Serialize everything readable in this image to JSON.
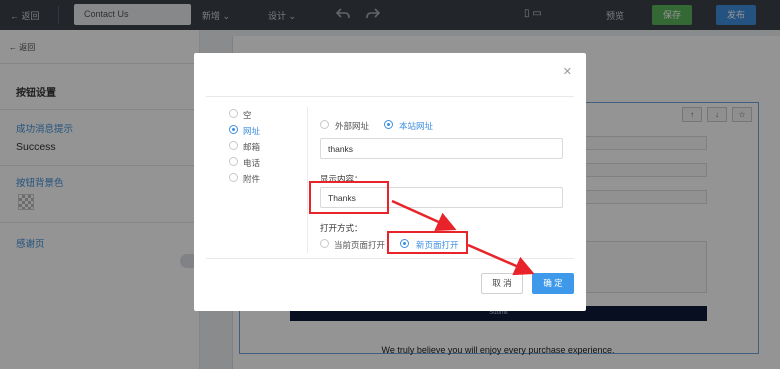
{
  "topbar": {
    "back_label": "返回",
    "page_title": "Contact Us",
    "menu_add": "新增",
    "menu_design": "设计",
    "preview_label": "预览",
    "save_label": "保存",
    "publish_label": "发布"
  },
  "left_panel": {
    "back_label": "返回",
    "heading": "按钮设置",
    "success_section": "成功消息提示",
    "success_text": "Success",
    "bg_color_section": "按钮背景色",
    "thanks_section": "感谢页"
  },
  "canvas": {
    "submit_label": "Submit",
    "footer_text": "We truly believe you will enjoy every purchase experience."
  },
  "modal": {
    "link_types": [
      {
        "label": "空",
        "selected": false
      },
      {
        "label": "网址",
        "selected": true
      },
      {
        "label": "邮箱",
        "selected": false
      },
      {
        "label": "电话",
        "selected": false
      },
      {
        "label": "附件",
        "selected": false
      }
    ],
    "url_types": [
      {
        "label": "外部网址",
        "selected": false
      },
      {
        "label": "本站网址",
        "selected": true
      }
    ],
    "url_value": "thanks",
    "display_label": "显示内容：",
    "display_value": "Thanks",
    "open_label": "打开方式：",
    "open_modes": [
      {
        "label": "当前页面打开",
        "selected": false
      },
      {
        "label": "新页面打开",
        "selected": true
      }
    ],
    "cancel_label": "取 消",
    "confirm_label": "确 定"
  },
  "colors": {
    "accent": "#3d8fe0",
    "highlight": "#e8242a",
    "save_green": "#5bb45b"
  }
}
